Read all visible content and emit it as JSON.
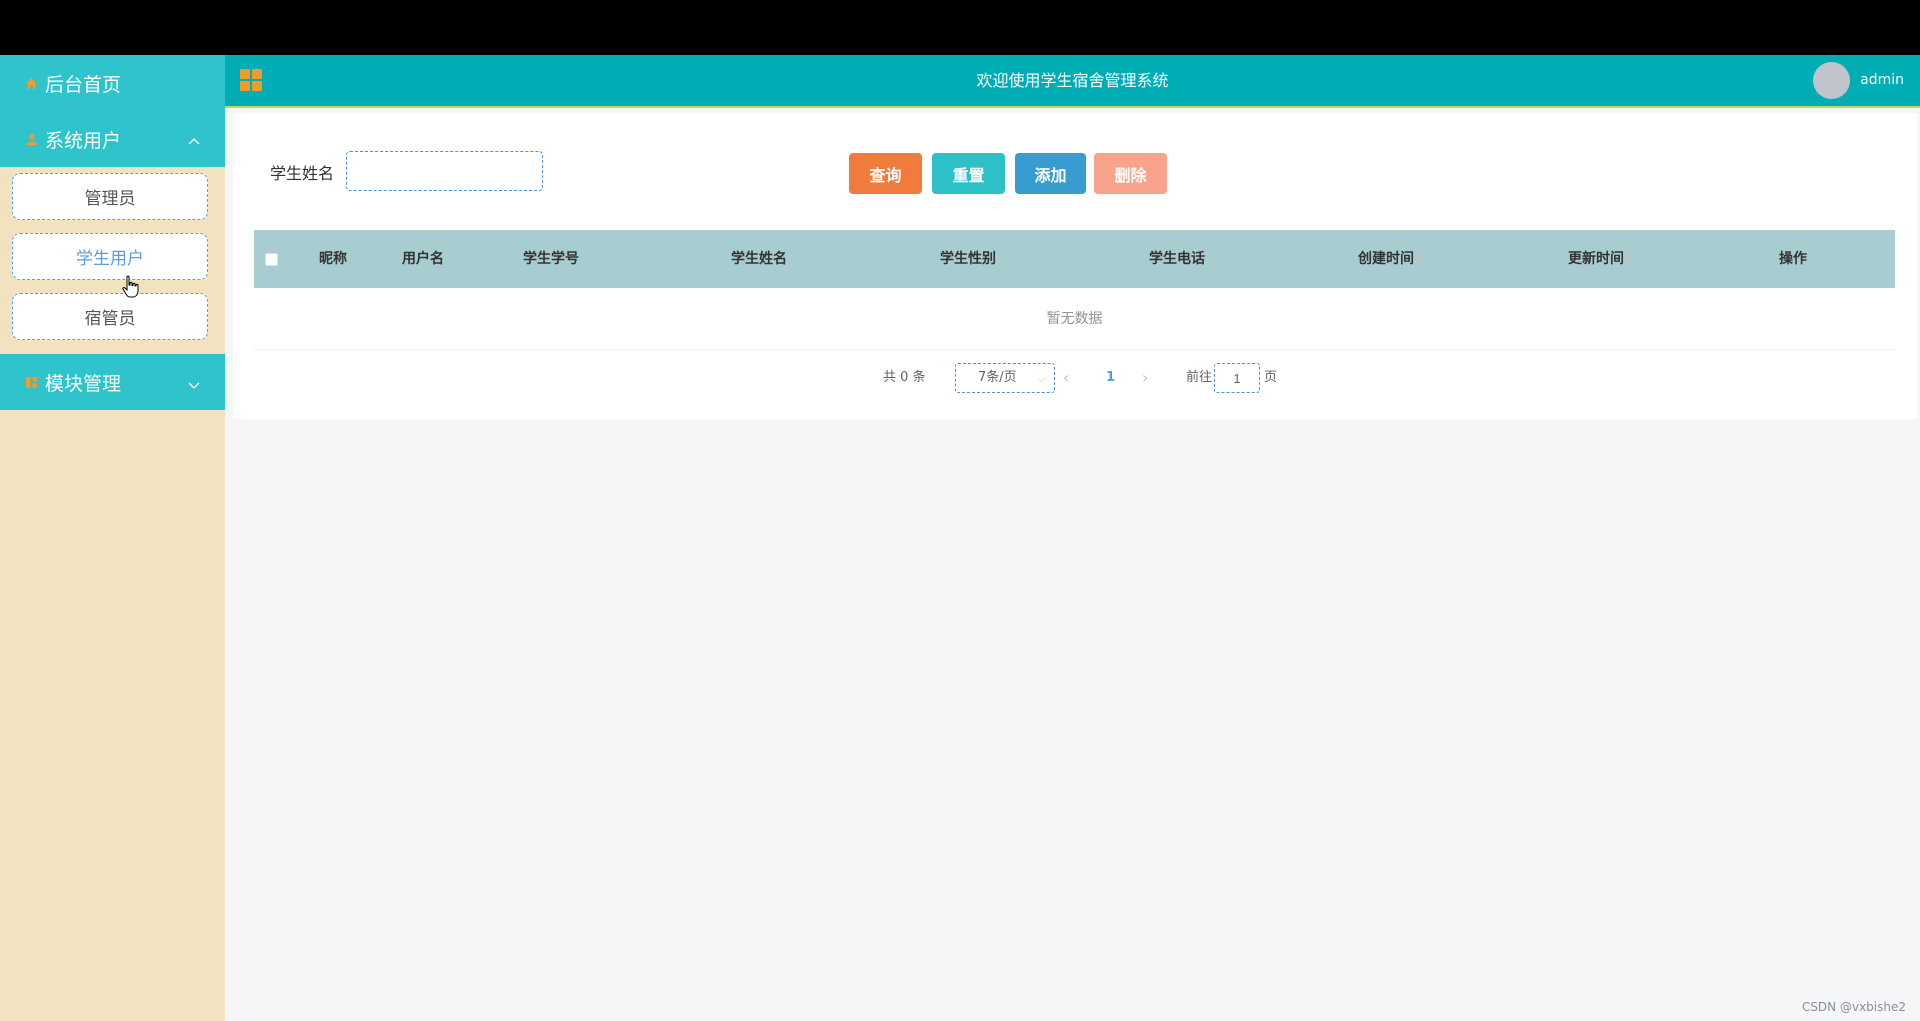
{
  "sidebar": {
    "home_label": "后台首页",
    "system_users_label": "系统用户",
    "sub_items": [
      "管理员",
      "学生用户",
      "宿管员"
    ],
    "module_label": "模块管理"
  },
  "header": {
    "title": "欢迎使用学生宿舍管理系统",
    "user": "admin"
  },
  "search": {
    "label": "学生姓名",
    "value": "",
    "placeholder": ""
  },
  "buttons": {
    "query": "查询",
    "reset": "重置",
    "add": "添加",
    "delete": "删除"
  },
  "table": {
    "columns": [
      "昵称",
      "用户名",
      "学生学号",
      "学生姓名",
      "学生性别",
      "学生电话",
      "创建时间",
      "更新时间",
      "操作"
    ],
    "empty_text": "暂无数据"
  },
  "pagination": {
    "total_text": "共 0 条",
    "page_size": "7条/页",
    "current_page": "1",
    "goto_label": "前往",
    "goto_value": "1",
    "page_suffix": "页"
  },
  "watermark": "CSDN @vxbishe2",
  "colors": {
    "sidebar_menu": "#2fc3cc",
    "sidebar_bg": "#f3e2c0",
    "header_bg": "#00adb5",
    "table_head": "#a8cdd1",
    "query_btn": "#ef7b3c",
    "reset_btn": "#2dc0c7",
    "add_btn": "#379ccf",
    "delete_btn": "#f8a48c"
  }
}
